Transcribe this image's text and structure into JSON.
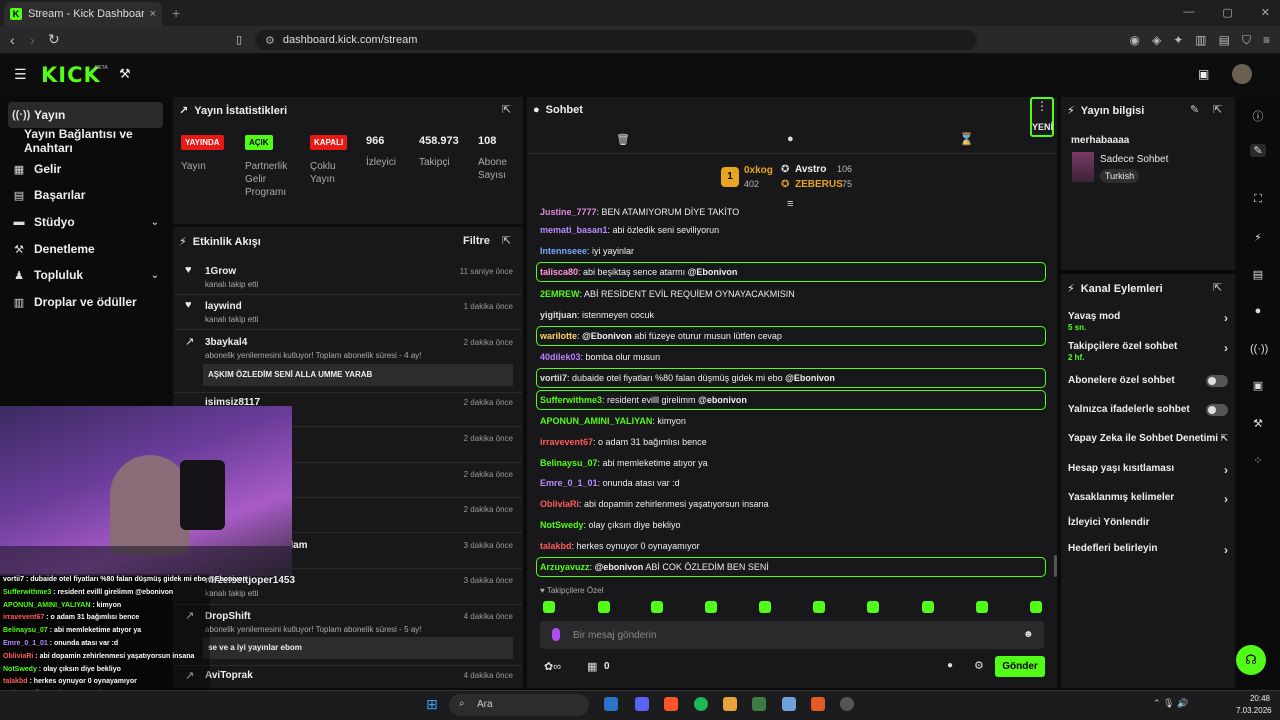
{
  "browser": {
    "tab_title": "Stream - Kick Dashboard",
    "url": "dashboard.kick.com/stream",
    "new_tab": "+",
    "close": "×"
  },
  "header": {
    "logo": "KICK",
    "beta": "BETA"
  },
  "sidebar": {
    "items": [
      {
        "label": "Yayın",
        "icon": "broadcast-icon"
      },
      {
        "label": "Yayın Bağlantısı ve Anahtarı",
        "icon": ""
      },
      {
        "label": "Gelir",
        "icon": "income-icon"
      },
      {
        "label": "Başarılar",
        "icon": "achievements-icon"
      },
      {
        "label": "Stüdyo",
        "icon": "studio-icon"
      },
      {
        "label": "Denetleme",
        "icon": "wrench-icon"
      },
      {
        "label": "Topluluk",
        "icon": "community-icon"
      },
      {
        "label": "Droplar ve ödüller",
        "icon": "drops-icon"
      }
    ]
  },
  "stats": {
    "title": "Yayın İstatistikleri",
    "badges": [
      {
        "label": "YAYINDA",
        "desc": "Yayın"
      },
      {
        "label": "AÇIK",
        "desc": "Partnerlik Gelir Programı"
      },
      {
        "label": "KAPALI",
        "desc": "Çoklu Yayın"
      }
    ],
    "numbers": [
      {
        "value": "966",
        "label": "İzleyici"
      },
      {
        "value": "458.973",
        "label": "Takipçi"
      },
      {
        "value": "108",
        "label": "Abone Sayısı"
      }
    ]
  },
  "activity": {
    "title": "Etkinlik Akışı",
    "filter": "Filtre",
    "events": [
      {
        "name": "1Grow",
        "sub": "kanalı takip etti",
        "time": "11 saniye önce"
      },
      {
        "name": "laywind",
        "sub": "kanalı takip etti",
        "time": "1 dakika önce"
      },
      {
        "name": "3baykal4",
        "sub": "abonelik yenilemesini kutluyor! Toplam abonelik süresi - 4 ay!",
        "time": "2 dakika önce",
        "msg": "AŞKIM ÖZLEDİM SENİ ALLA UMME YARAB"
      },
      {
        "name": "isimsiz8117",
        "sub": "",
        "time": "2 dakika önce"
      },
      {
        "name": "",
        "sub": "",
        "time": "2 dakika önce"
      },
      {
        "name": "",
        "sub": "",
        "time": "2 dakika önce"
      },
      {
        "name": "",
        "sub": "",
        "time": "2 dakika önce"
      },
      {
        "name": "dam",
        "sub": "",
        "time": "3 dakika önce"
      },
      {
        "name": "mrzeiseitjoper1453",
        "sub": "kanalı takip etti",
        "time": "3 dakika önce"
      },
      {
        "name": "DropShift",
        "sub": "abonelik yenilemesini kutluyor! Toplam abonelik süresi - 5 ay!",
        "time": "4 dakika önce",
        "msg": "se ve a iyi yayınlar ebom"
      },
      {
        "name": "AviToprak",
        "sub": "",
        "time": "4 dakika önce"
      }
    ]
  },
  "chat": {
    "title": "Sohbet",
    "new_label": "YENİ",
    "leaders": {
      "first": {
        "rank": "1",
        "name": "0xkog",
        "value": "402"
      },
      "second": {
        "name": "Avstro",
        "value": "106"
      },
      "third": {
        "name": "ZEBERUS",
        "value": "75"
      }
    },
    "messages": [
      {
        "user": "Justine_7777",
        "text": ": BEN ATAMIYORUM DİYE TAKİTO",
        "color": "#e08be0",
        "hl": false
      },
      {
        "user": "memati_basan1",
        "text": ": abi özledik seni seviliyorun",
        "color": "#b98bff",
        "hl": false
      },
      {
        "user": "Intennseee",
        "text": ": iyi yayinlar",
        "color": "#7aa7ff",
        "hl": false
      },
      {
        "user": "talisca80",
        "text": ": abi beşiktaş sence atarmı ",
        "mention": "@Ebonivon",
        "color": "#ff9ad5",
        "hl": true
      },
      {
        "user": "2EMREW",
        "text": ": ABİ RESİDENT EVİL REQUİEM OYNAYACAKMISIN",
        "color": "#53fc18",
        "hl": false
      },
      {
        "user": "yigitjuan",
        "text": ": istenmeyen cocuk",
        "color": "#ddd",
        "hl": false
      },
      {
        "user": "warilotte",
        "text": ": ",
        "mention": "@Ebonivon",
        "tail": " abi füzeye oturur musun lütfen cevap",
        "color": "#ffd36b",
        "hl": true
      },
      {
        "user": "40dilek03",
        "text": ": bomba olur musun",
        "color": "#c07bff",
        "hl": false
      },
      {
        "user": "vortii7",
        "text": ": dubaide otel fiyatları %80 falan düşmüş gidek mi ebo ",
        "mention": "@Ebonivon",
        "color": "#ddd",
        "hl": true
      },
      {
        "user": "Sufferwithme3",
        "text": ": resident evilll girelimm ",
        "mention": "@ebonivon",
        "color": "#53fc18",
        "hl": true
      },
      {
        "user": "APONUN_AMINI_YALIYAN",
        "text": ": kimyon",
        "color": "#53fc18",
        "hl": false
      },
      {
        "user": "irravevent67",
        "text": ": o adam 31 bağımlısı bence",
        "color": "#ff5b5b",
        "hl": false
      },
      {
        "user": "Belinaysu_07",
        "text": ": abi memleketime atıyor ya",
        "color": "#53fc18",
        "hl": false
      },
      {
        "user": "Emre_0_1_01",
        "text": ": onunda atası var :d",
        "color": "#b98bff",
        "hl": false
      },
      {
        "user": "ObliviaRi",
        "text": ": abi dopamin zehirlenmesi yaşatıyorsun insana",
        "color": "#ff5b5b",
        "hl": false
      },
      {
        "user": "NotSwedy",
        "text": ": olay çıksın diye bekliyo",
        "color": "#53fc18",
        "hl": false
      },
      {
        "user": "talakbd",
        "text": ": herkes oynuyor 0 oynayamıyor",
        "color": "#ff5b5b",
        "hl": false
      },
      {
        "user": "Arzuyavuzz",
        "text": ": ",
        "mention": "@ebonivon",
        "tail": " ABİ COK ÖZLEDİM BEN SENİ",
        "color": "#53fc18",
        "hl": true
      }
    ],
    "followers_only": "Takipçilere Özel",
    "input_placeholder": "Bir mesaj gönderin",
    "count": "0",
    "send": "Gönder"
  },
  "stream_info": {
    "title": "Yayın bilgisi",
    "stream_title": "merhabaaaa",
    "category": "Sadece Sohbet",
    "language": "Turkish"
  },
  "channel_actions": {
    "title": "Kanal Eylemleri",
    "rows": [
      {
        "label": "Yavaş mod",
        "sub": "5 sn.",
        "type": "chevron"
      },
      {
        "label": "Takipçilere özel sohbet",
        "sub": "2 hf.",
        "type": "chevron"
      },
      {
        "label": "Abonelere özel sohbet",
        "sub": "",
        "type": "toggle"
      },
      {
        "label": "Yalnızca ifadelerle sohbet",
        "sub": "",
        "type": "toggle"
      },
      {
        "label": "Yapay Zeka ile Sohbet Denetimi",
        "sub": "",
        "type": "external"
      },
      {
        "label": "Hesap yaşı kısıtlaması",
        "sub": "",
        "type": "chevron"
      },
      {
        "label": "Yasaklanmış kelimeler",
        "sub": "",
        "type": "chevron"
      },
      {
        "label": "İzleyici Yönlendir",
        "sub": "",
        "type": "none"
      },
      {
        "label": "Hedefleri belirleyin",
        "sub": "",
        "type": "chevron"
      }
    ]
  },
  "overlay_chat": [
    {
      "user": "vortii7",
      "text": " : dubaide otel fiyatları %80 falan düşmüş gidek mi ebo @Ebonivon",
      "color": "#fff"
    },
    {
      "user": "Sufferwithme3",
      "text": " : resident evilll girelimm @ebonivon",
      "color": "#53fc18"
    },
    {
      "user": "APONUN_AMINI_YALIYAN",
      "text": " : kimyon",
      "color": "#53fc18"
    },
    {
      "user": "irravevent67",
      "text": " : o adam 31 bağımlısı bence",
      "color": "#ff5b5b"
    },
    {
      "user": "Belinaysu_07",
      "text": " : abi memleketime atıyor ya",
      "color": "#53fc18"
    },
    {
      "user": "Emre_0_1_01",
      "text": " : onunda atası var :d",
      "color": "#b98bff"
    },
    {
      "user": "ObliviaRi",
      "text": " : abi dopamin zehirlenmesi yaşatıyorsun insana",
      "color": "#ff5b5b"
    },
    {
      "user": "NotSwedy",
      "text": " : olay çıksın diye bekliyo",
      "color": "#53fc18"
    },
    {
      "user": "talakbd",
      "text": " : herkes oynuyor 0 oynayamıyor",
      "color": "#ff5b5b"
    },
    {
      "user": "",
      "text": "ABİ COK ÖZLEDİM BEN SENİ",
      "color": "#fff"
    }
  ],
  "taskbar": {
    "search": "Ara",
    "time": "20:48",
    "date": "7.03.2026"
  },
  "colors": {
    "accent": "#53fc18",
    "live": "#e91916",
    "panel": "#18181a"
  }
}
